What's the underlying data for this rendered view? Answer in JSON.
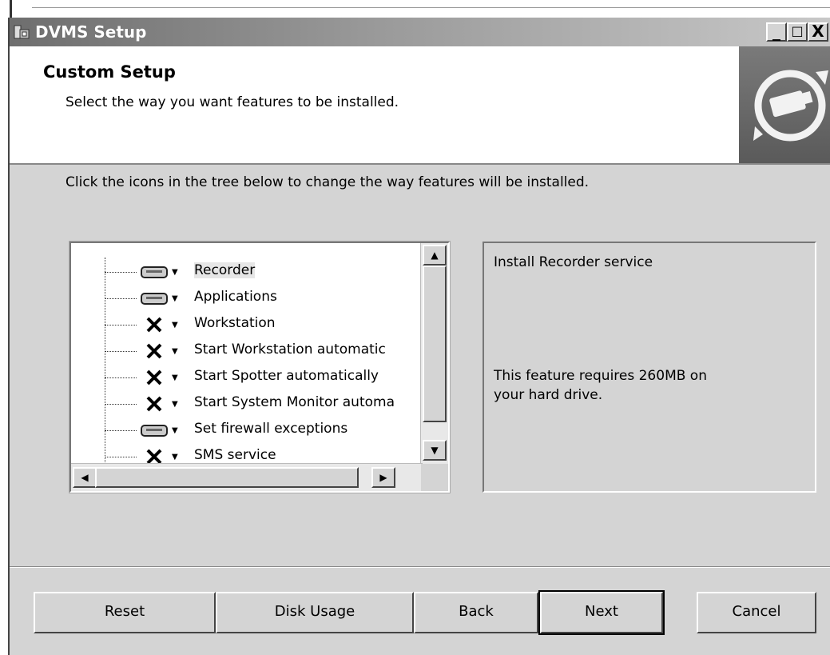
{
  "window": {
    "title": "DVMS Setup",
    "controls": {
      "minimize": "_",
      "maximize": "□",
      "close": "X"
    }
  },
  "header": {
    "heading": "Custom Setup",
    "subtitle": "Select the way you want features to be installed."
  },
  "instruction": "Click the icons in the tree below to change the way features will be installed.",
  "tree": {
    "items": [
      {
        "label": "Recorder",
        "state": "install-local",
        "icon": "drive-icon",
        "selected": true
      },
      {
        "label": "Applications",
        "state": "install-local",
        "icon": "drive-icon",
        "selected": false
      },
      {
        "label": "Workstation",
        "state": "not-available",
        "icon": "x-icon",
        "selected": false
      },
      {
        "label": "Start Workstation automatic",
        "state": "not-available",
        "icon": "x-icon",
        "selected": false
      },
      {
        "label": "Start Spotter automatically",
        "state": "not-available",
        "icon": "x-icon",
        "selected": false
      },
      {
        "label": "Start System Monitor automa",
        "state": "not-available",
        "icon": "x-icon",
        "selected": false
      },
      {
        "label": "Set firewall exceptions",
        "state": "install-local",
        "icon": "drive-icon",
        "selected": false
      },
      {
        "label": "SMS service",
        "state": "not-available",
        "icon": "x-icon",
        "selected": false
      }
    ]
  },
  "description": {
    "text": "Install Recorder service",
    "size_text": "This feature requires 260MB on your hard drive."
  },
  "buttons": {
    "reset": "Reset",
    "disk_usage": "Disk Usage",
    "back": "Back",
    "next": "Next",
    "cancel": "Cancel"
  }
}
